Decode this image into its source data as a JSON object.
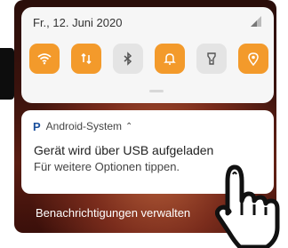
{
  "status": {
    "date": "Fr., 12. Juni 2020",
    "signal_icon": "signal-icon"
  },
  "quick_settings": {
    "tiles": [
      {
        "name": "wifi",
        "icon": "wifi-icon",
        "state": "on"
      },
      {
        "name": "mobile-data",
        "icon": "mobile-data-icon",
        "state": "on"
      },
      {
        "name": "bluetooth",
        "icon": "bluetooth-icon",
        "state": "off"
      },
      {
        "name": "sound",
        "icon": "bell-icon",
        "state": "on"
      },
      {
        "name": "flashlight",
        "icon": "flashlight-icon",
        "state": "off"
      },
      {
        "name": "location",
        "icon": "location-icon",
        "state": "on"
      }
    ],
    "accent": "#f39a2b"
  },
  "notification": {
    "app_name": "Android-System",
    "app_icon_letter": "P",
    "title": "Gerät wird über USB aufgeladen",
    "text": "Für weitere Optionen tippen."
  },
  "footer": {
    "manage_label": "Benachrichtigungen verwalten"
  }
}
